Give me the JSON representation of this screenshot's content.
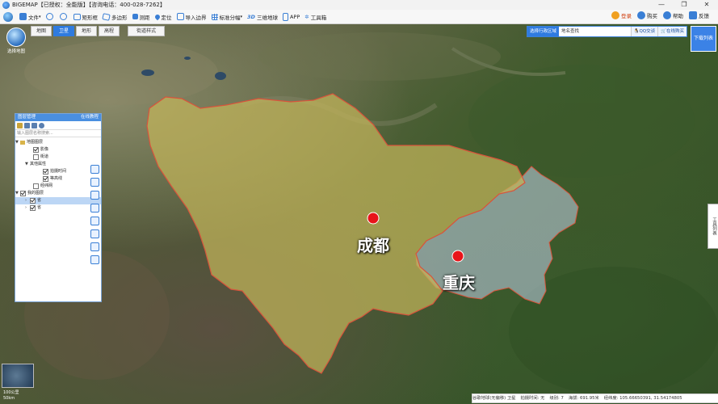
{
  "window": {
    "title": "BIGEMAP【已授权：全能版】【咨询电话：400-028-7262】",
    "controls": [
      "—",
      "❐",
      "✕"
    ]
  },
  "toolbar": {
    "items": [
      {
        "label": "文件",
        "icon": "folder-icon"
      },
      {
        "label": "",
        "icon": "zoom-out-icon"
      },
      {
        "label": "",
        "icon": "zoom-in-icon"
      },
      {
        "label": "矩形框",
        "icon": "rectangle-icon"
      },
      {
        "label": "多边形",
        "icon": "polygon-icon"
      },
      {
        "label": "测距",
        "icon": "ruler-icon"
      },
      {
        "label": "定位",
        "icon": "location-pin-icon"
      },
      {
        "label": "导入边界",
        "icon": "import-icon"
      },
      {
        "label": "标准分幅",
        "icon": "grid-icon"
      },
      {
        "label": "三维地球",
        "icon": "3d-icon"
      },
      {
        "label": "APP",
        "icon": "phone-icon"
      },
      {
        "label": "工具箱",
        "icon": "toolbox-icon"
      }
    ],
    "right": [
      {
        "label": "登录",
        "icon": "user-icon"
      },
      {
        "label": "购买",
        "icon": "vip-icon"
      },
      {
        "label": "帮助",
        "icon": "help-icon"
      },
      {
        "label": "反馈",
        "icon": "feedback-icon"
      }
    ]
  },
  "logo": {
    "label": "选择地图"
  },
  "map_tabs": [
    {
      "label": "地图",
      "active": false
    },
    {
      "label": "卫星",
      "active": true
    },
    {
      "label": "地形",
      "active": false
    },
    {
      "label": "高程",
      "active": false
    },
    {
      "label": "街道样式",
      "active": false
    }
  ],
  "region_bar": {
    "select_label": "选择行政区域",
    "search_placeholder": "地名查找",
    "qq_label": "QQ交谈",
    "service_label": "在线购买"
  },
  "download_button": "下载列表",
  "layer_panel": {
    "title": "图层管理",
    "link": "在线教程",
    "search_placeholder": "输入图层名称搜索...",
    "tree": [
      {
        "label": "地图图层",
        "checked": false,
        "level": 0,
        "folder": true
      },
      {
        "label": "影像",
        "checked": true,
        "level": 1
      },
      {
        "label": "街道",
        "checked": false,
        "level": 1
      },
      {
        "label": "其他属性",
        "checked": false,
        "level": 1,
        "folder": true
      },
      {
        "label": "拍摄时间",
        "checked": true,
        "level": 2
      },
      {
        "label": "等高线",
        "checked": true,
        "level": 2
      },
      {
        "label": "经纬网",
        "checked": false,
        "level": 1
      },
      {
        "label": "我的图层",
        "checked": true,
        "level": 0,
        "folder": true
      },
      {
        "label": "省",
        "checked": true,
        "level": 1
      },
      {
        "label": "省",
        "checked": true,
        "level": 1
      }
    ]
  },
  "cities": [
    {
      "name": "成都",
      "marker_color": "#e8141a"
    },
    {
      "name": "重庆",
      "marker_color": "#e8141a"
    }
  ],
  "colors": {
    "sichuan_fill": "#c2b45a",
    "chongqing_fill": "#b8c8d8",
    "border": "#d9533b",
    "accent": "#2f7be0"
  },
  "right_tools": "工具列表",
  "scale": {
    "label1": "100公里",
    "label2": "50km"
  },
  "status": {
    "source": "谷歌地球(无偏移) 卫星",
    "capture": "拍摄时间: 无",
    "level": "级别: 7",
    "altitude": "海拔: 691.95米",
    "coords": "经纬度: 105.66650391, 31.54174805"
  }
}
